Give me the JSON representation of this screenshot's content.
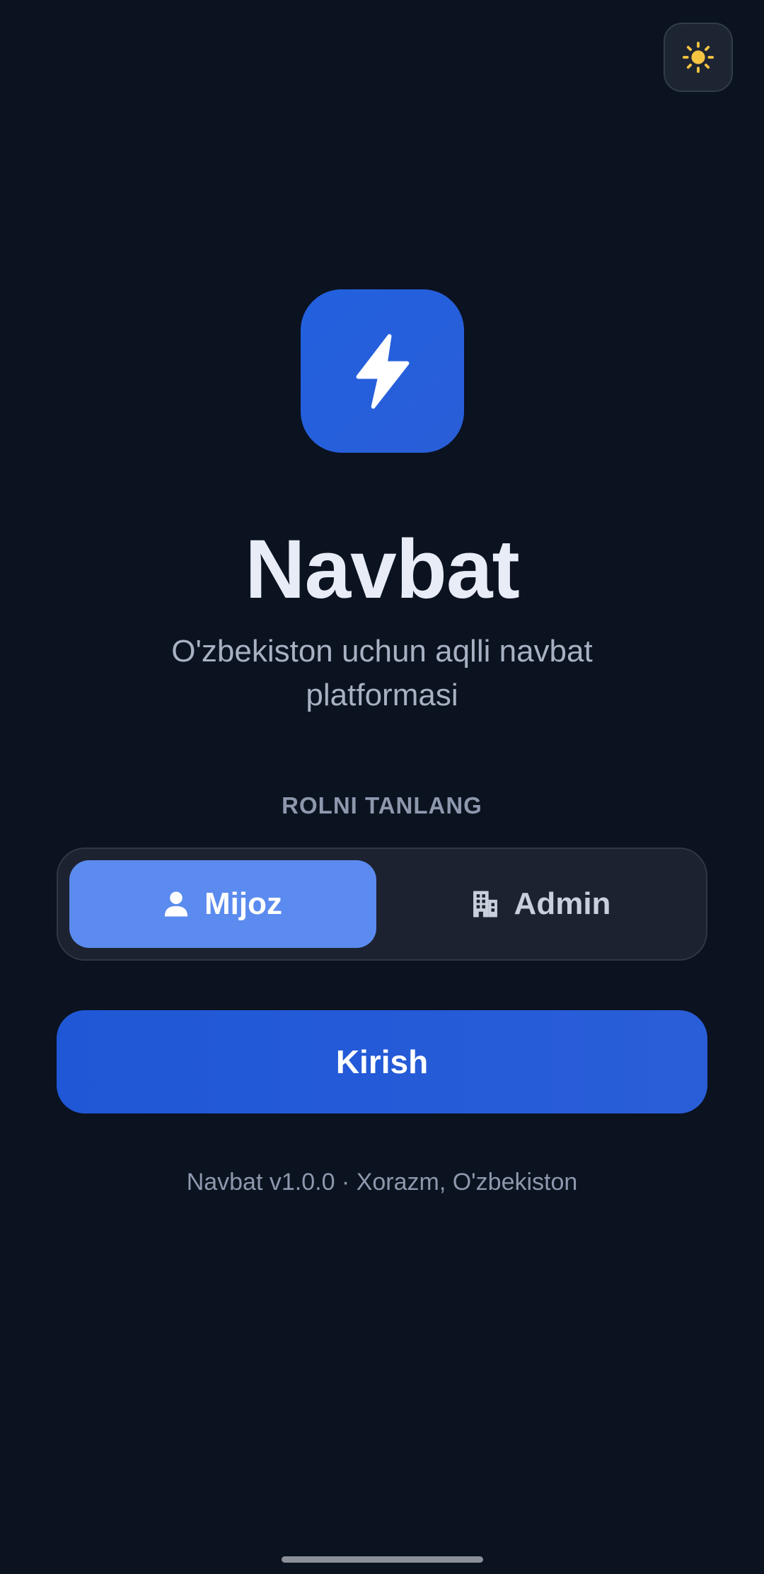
{
  "app": {
    "title": "Navbat",
    "subtitle": "O'zbekiston uchun aqlli navbat platformasi"
  },
  "icons": {
    "theme_toggle": "sun-icon",
    "logo": "lightning-bolt-icon",
    "client_role": "user-icon",
    "admin_role": "building-icon"
  },
  "role_select": {
    "label": "ROLNI TANLANG",
    "options": [
      {
        "label": "Mijoz",
        "selected": true
      },
      {
        "label": "Admin",
        "selected": false
      }
    ]
  },
  "login_button": {
    "label": "Kirish"
  },
  "footer": {
    "text": "Navbat v1.0.0 · Xorazm, O'zbekiston"
  },
  "colors": {
    "background": "#0b1220",
    "accent": "#2260de",
    "selected_role": "#5b8bee",
    "sun": "#f5c542"
  }
}
